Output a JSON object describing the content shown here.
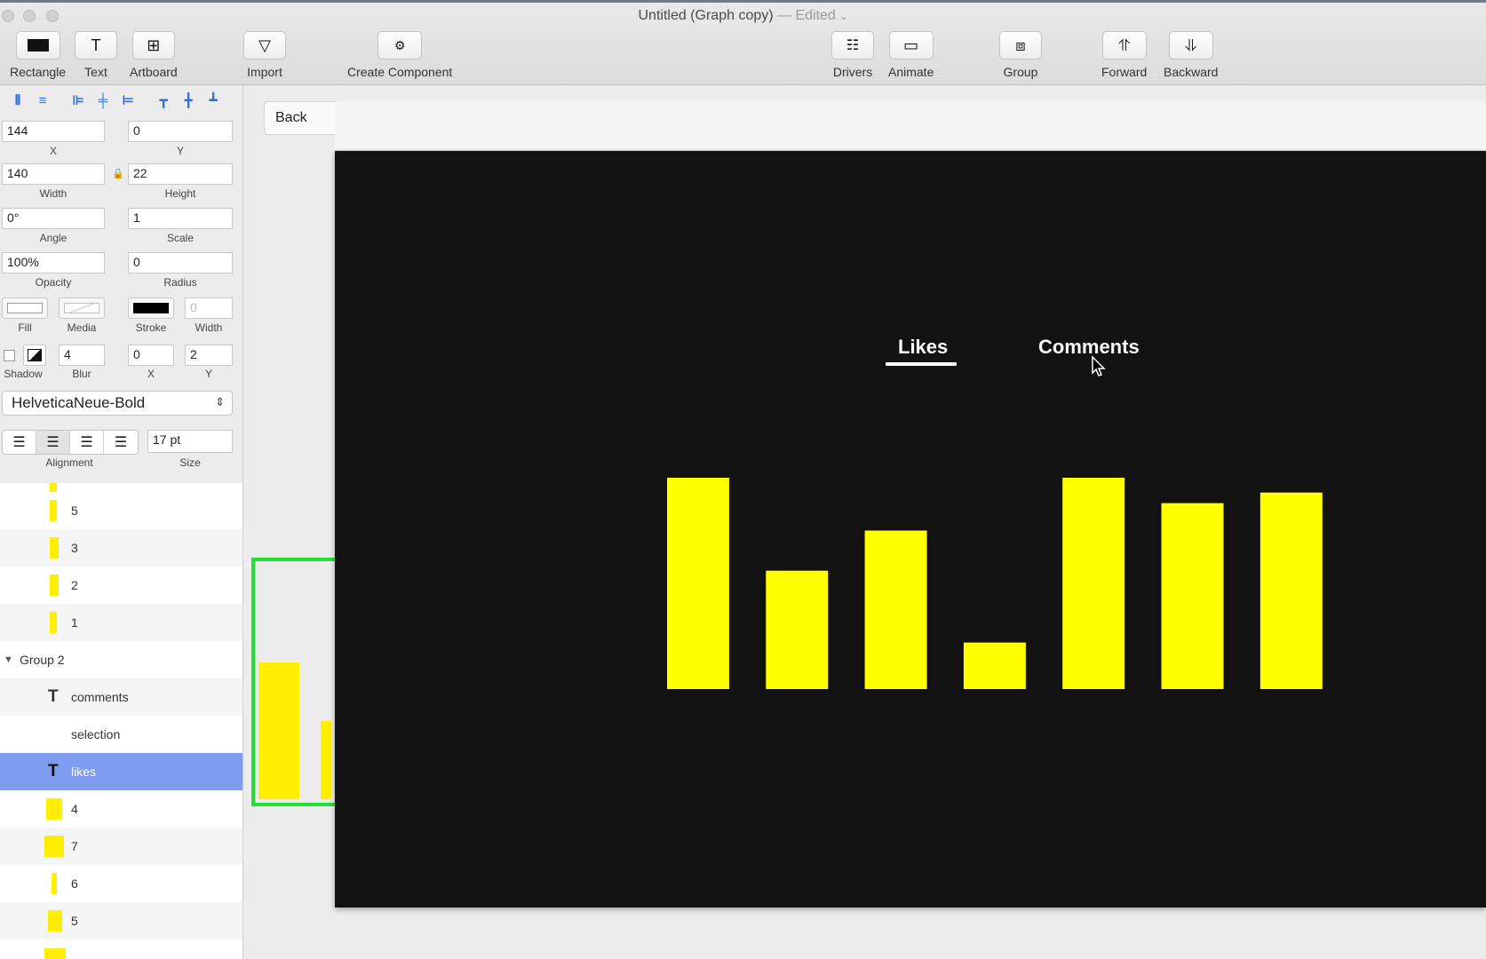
{
  "window": {
    "title": "Untitled (Graph copy)",
    "edited": "— Edited"
  },
  "toolbar": {
    "tools": [
      {
        "label": "Rectangle",
        "icon": "rectangle-icon"
      },
      {
        "label": "Text",
        "icon": "text-icon"
      },
      {
        "label": "Artboard",
        "icon": "artboard-icon"
      },
      {
        "label": "Import",
        "icon": "import-icon"
      },
      {
        "label": "Create Component",
        "icon": "component-icon"
      },
      {
        "label": "Drivers",
        "icon": "drivers-icon"
      },
      {
        "label": "Animate",
        "icon": "animate-icon"
      },
      {
        "label": "Group",
        "icon": "group-icon"
      },
      {
        "label": "Forward",
        "icon": "forward-icon"
      },
      {
        "label": "Backward",
        "icon": "backward-icon"
      }
    ]
  },
  "inspector": {
    "x": {
      "value": "144",
      "label": "X"
    },
    "y": {
      "value": "0",
      "label": "Y"
    },
    "width": {
      "value": "140",
      "label": "Width"
    },
    "height": {
      "value": "22",
      "label": "Height"
    },
    "angle": {
      "value": "0°",
      "label": "Angle"
    },
    "scale": {
      "value": "1",
      "label": "Scale"
    },
    "opacity": {
      "value": "100%",
      "label": "Opacity"
    },
    "radius": {
      "value": "0",
      "label": "Radius"
    },
    "fill_label": "Fill",
    "media_label": "Media",
    "stroke_label": "Stroke",
    "stroke_width": {
      "value": "0",
      "label": "Width"
    },
    "shadow_label": "Shadow",
    "blur": {
      "value": "4",
      "label": "Blur"
    },
    "shadow_x": {
      "value": "0",
      "label": "X"
    },
    "shadow_y": {
      "value": "2",
      "label": "Y"
    },
    "font": "HelveticaNeue-Bold",
    "alignment_label": "Alignment",
    "size": {
      "value": "17 pt",
      "label": "Size"
    }
  },
  "layers": [
    {
      "name": "5",
      "kind": "rect"
    },
    {
      "name": "3",
      "kind": "rect"
    },
    {
      "name": "2",
      "kind": "rect"
    },
    {
      "name": "1",
      "kind": "rect"
    },
    {
      "name": "Group 2",
      "kind": "group"
    },
    {
      "name": "comments",
      "kind": "text"
    },
    {
      "name": "selection",
      "kind": "plain"
    },
    {
      "name": "likes",
      "kind": "text",
      "selected": true
    },
    {
      "name": "4",
      "kind": "rect"
    },
    {
      "name": "7",
      "kind": "rect"
    },
    {
      "name": "6",
      "kind": "rect"
    },
    {
      "name": "5",
      "kind": "rect"
    }
  ],
  "canvas": {
    "back_button": "Back",
    "tabs": {
      "likes": "Likes",
      "comments": "Comments"
    }
  },
  "chart_data": {
    "type": "bar",
    "values": [
      100,
      56,
      75,
      22,
      100,
      88,
      93
    ],
    "ylim": [
      0,
      100
    ],
    "color": "#ffff00",
    "background": "#121212"
  },
  "colors": {
    "accent_selection": "#7e9df0",
    "bar_yellow": "#ffff00",
    "selection_outline": "#22e033"
  }
}
